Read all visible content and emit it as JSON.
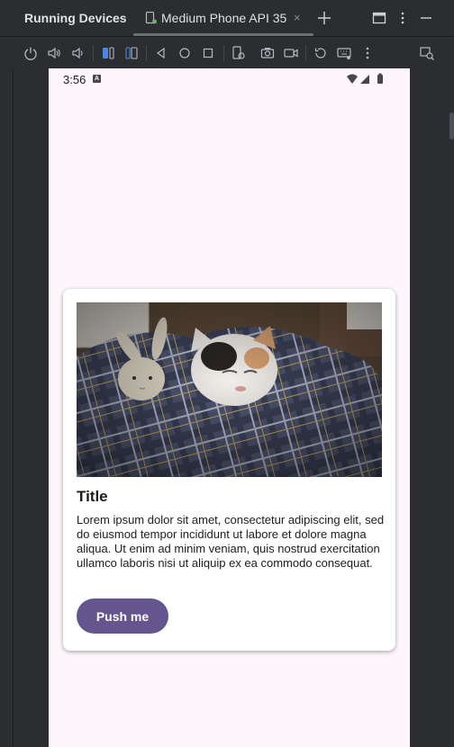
{
  "window": {
    "title": "Running Devices",
    "tab_label": "Medium Phone API 35",
    "tab_close": "×"
  },
  "toolbar": {
    "icons": [
      "power-icon",
      "volume-up-icon",
      "volume-down-icon",
      "rotate-left-icon",
      "rotate-right-icon",
      "back-icon",
      "home-icon",
      "overview-icon",
      "device-mirror-icon",
      "screenshot-icon",
      "screen-record-icon",
      "reset-icon",
      "keyboard-icon",
      "more-icon",
      "device-search-icon"
    ]
  },
  "device": {
    "status_time": "3:56",
    "status_a": "A"
  },
  "card": {
    "title": "Title",
    "body": "Lorem ipsum dolor sit amet, consectetur adipiscing elit, sed do eiusmod tempor incididunt ut labore et dolore magna aliqua. Ut enim ad minim veniam, quis nostrud exercitation ullamco laboris nisi ut aliquip ex ea commodo consequat.",
    "button_label": "Push me"
  },
  "colors": {
    "ide_background": "#2b2d30",
    "device_background": "#fdf7fd",
    "button": "#65558f"
  }
}
